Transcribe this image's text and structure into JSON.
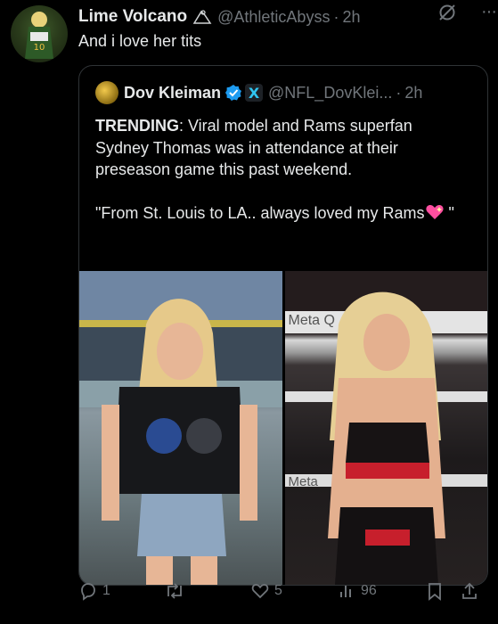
{
  "tweet": {
    "display_name": "Lime Volcano",
    "handle": "@AthleticAbyss",
    "separator": "·",
    "time": "2h",
    "text": "And i love her tits"
  },
  "quoted": {
    "display_name": "Dov Kleiman",
    "affiliate_badge": "X",
    "handle": "@NFL_DovKlei...",
    "separator": "·",
    "time": "2h",
    "trending_label": "TRENDING",
    "body_line1": ": Viral model and Rams superfan Sydney Thomas was in attendance at their preseason game this past weekend.",
    "body_line2": "\"From St. Louis to LA.. always loved my Rams",
    "body_line2_end": " \"",
    "photos": {
      "left_alt": "Woman in Rams t-shirt at stadium",
      "right_alt": "Woman in red and black outfit at boxing ring",
      "banner_text_1": "Meta Q",
      "banner_text_2": "Meta"
    }
  },
  "actions": {
    "replies": "1",
    "reposts": "",
    "likes": "5",
    "views": "96"
  },
  "colors": {
    "background": "#000000",
    "text": "#e7e9ea",
    "muted": "#71767b",
    "verified": "#1d9bf0",
    "border": "#2f3336"
  }
}
